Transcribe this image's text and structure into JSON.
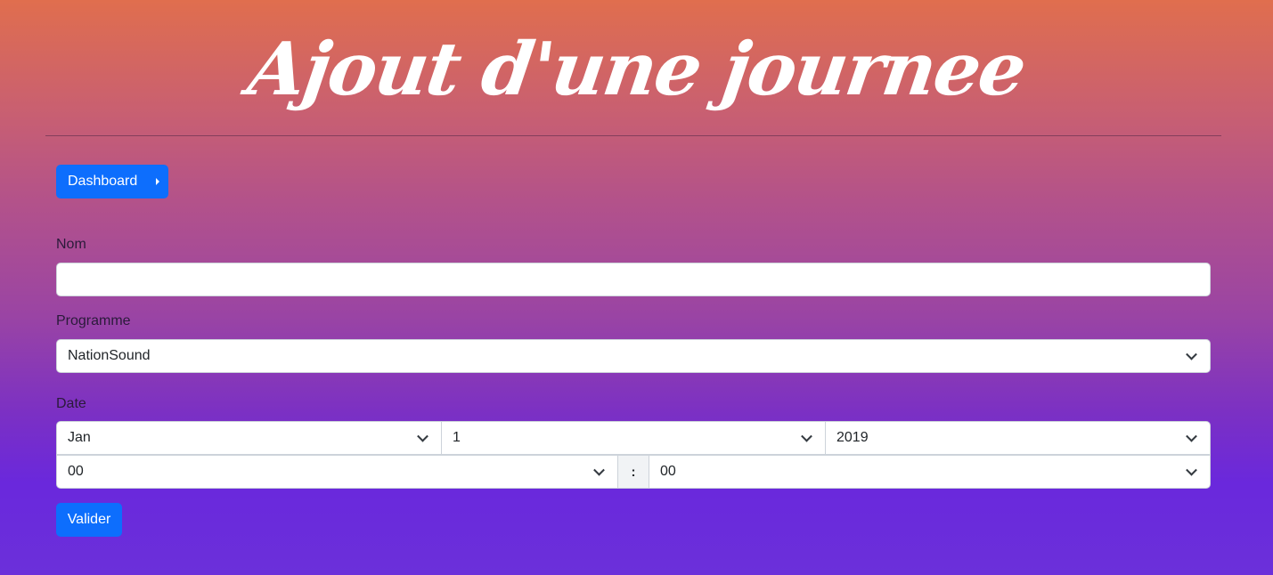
{
  "page": {
    "title": "Ajout d'une journee"
  },
  "nav": {
    "dashboard_label": "Dashboard"
  },
  "form": {
    "nom": {
      "label": "Nom",
      "value": ""
    },
    "programme": {
      "label": "Programme",
      "value": "NationSound"
    },
    "date": {
      "label": "Date",
      "month": "Jan",
      "day": "1",
      "year": "2019",
      "hour": "00",
      "separator": ":",
      "minute": "00"
    },
    "submit_label": "Valider"
  },
  "colors": {
    "primary": "#0d6efd"
  }
}
